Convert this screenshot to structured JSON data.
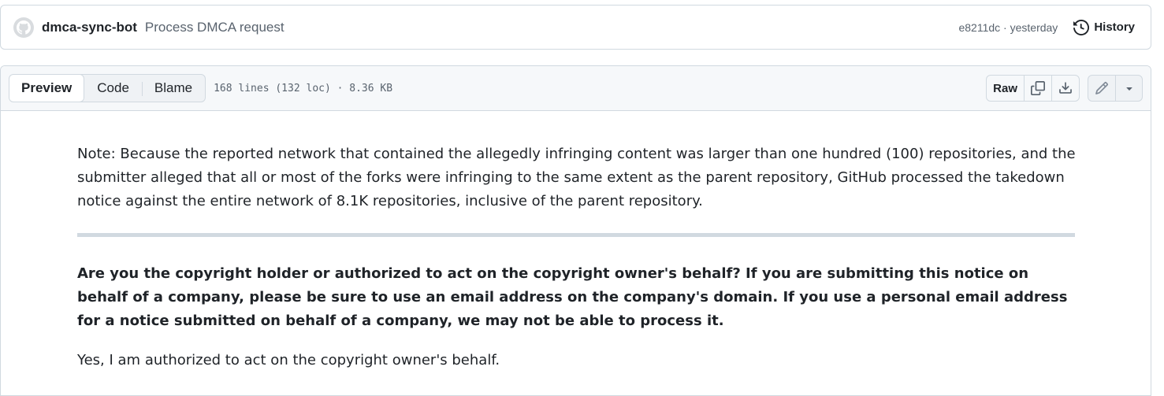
{
  "commit": {
    "author": "dmca-sync-bot",
    "message": "Process DMCA request",
    "meta": "e8211dc · yesterday",
    "history_label": "History"
  },
  "file_header": {
    "tabs": [
      {
        "label": "Preview",
        "active": true
      },
      {
        "label": "Code",
        "active": false
      },
      {
        "label": "Blame",
        "active": false
      }
    ],
    "info": "168 lines (132 loc) · 8.36 KB",
    "raw_label": "Raw"
  },
  "content": {
    "note": "Note: Because the reported network that contained the allegedly infringing content was larger than one hundred (100) repositories, and the submitter alleged that all or most of the forks were infringing to the same extent as the parent repository, GitHub processed the takedown notice against the entire network of 8.1K repositories, inclusive of the parent repository.",
    "question": "Are you the copyright holder or authorized to act on the copyright owner's behalf? If you are submitting this notice on behalf of a company, please be sure to use an email address on the company's domain. If you use a personal email address for a notice submitted on behalf of a company, we may not be able to process it.",
    "answer": "Yes, I am authorized to act on the copyright owner's behalf."
  },
  "icons": [
    "github-avatar-icon",
    "history-icon",
    "copy-icon",
    "download-icon",
    "pencil-icon",
    "triangle-down-icon"
  ]
}
